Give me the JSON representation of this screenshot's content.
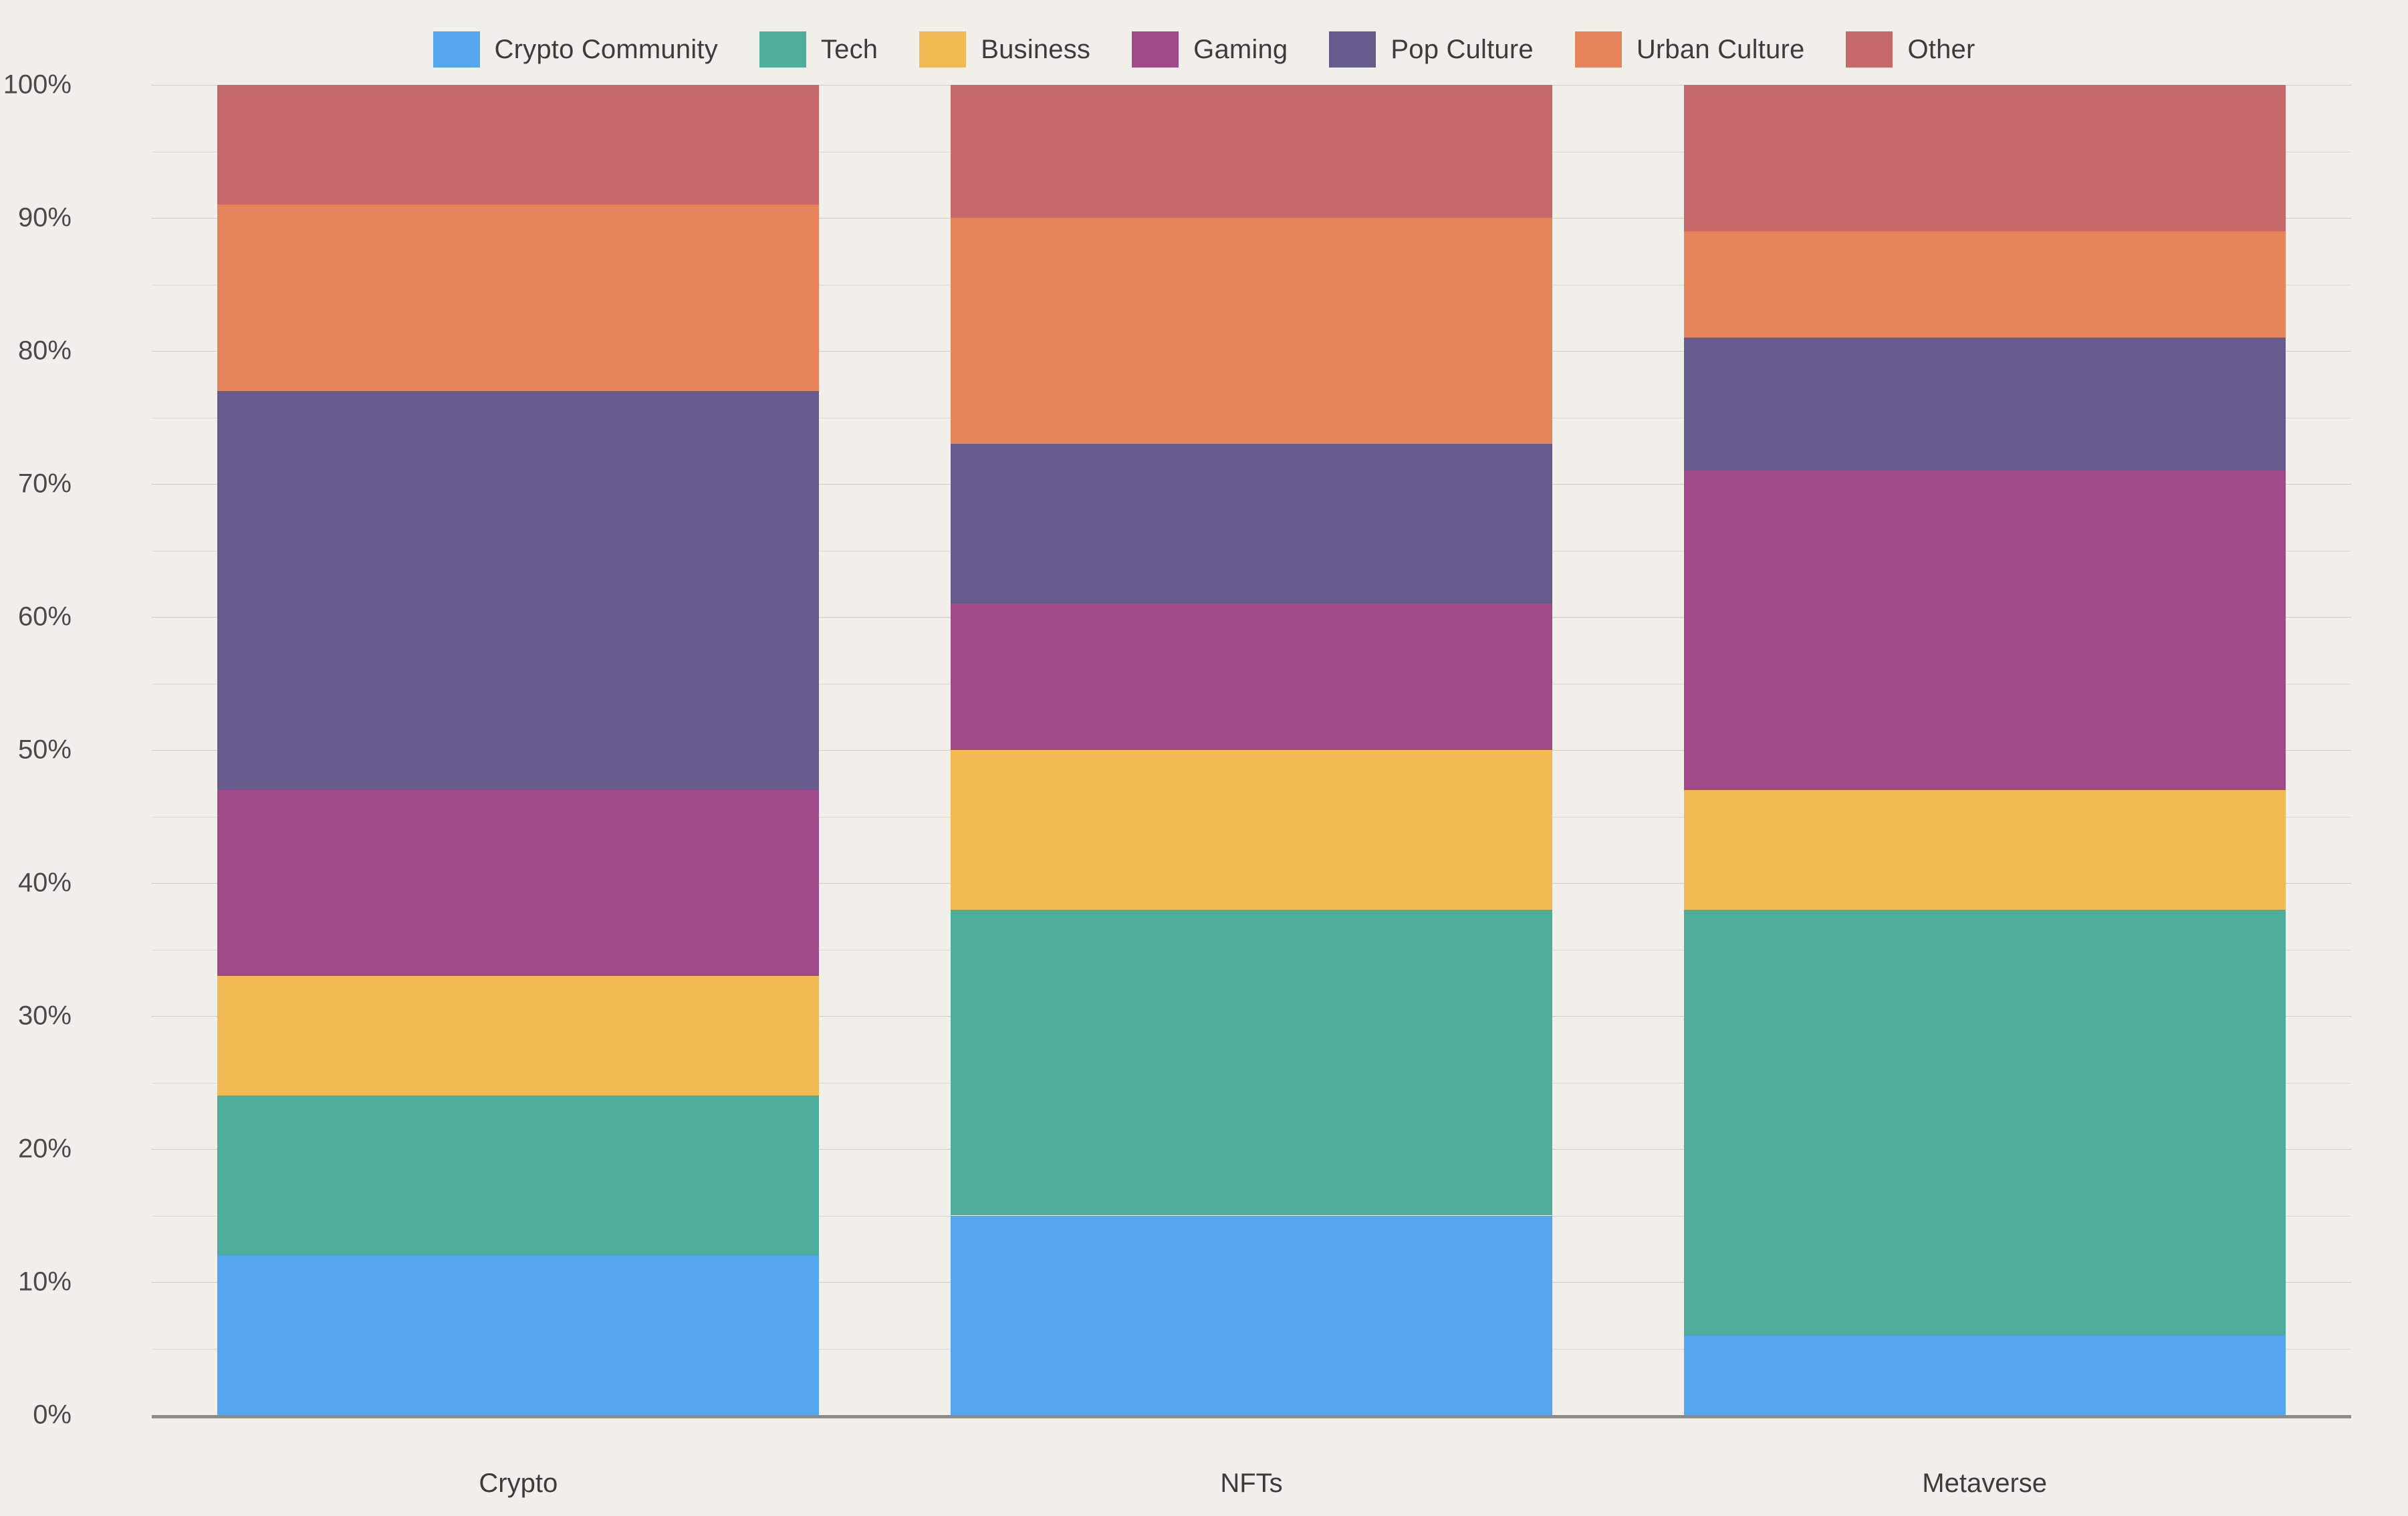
{
  "legend": {
    "position": "top-center",
    "items": [
      {
        "label": "Crypto Community",
        "color": "#54a6ee"
      },
      {
        "label": "Tech",
        "color": "#4fae9b"
      },
      {
        "label": "Business",
        "color": "#f1ba53"
      },
      {
        "label": "Gaming",
        "color": "#a2498a"
      },
      {
        "label": "Pop Culture",
        "color": "#675a8c"
      },
      {
        "label": "Urban Culture",
        "color": "#e6845b"
      },
      {
        "label": "Other",
        "color": "#c5696b"
      }
    ]
  },
  "axes": {
    "y_ticks": [
      "0%",
      "10%",
      "20%",
      "30%",
      "40%",
      "50%",
      "60%",
      "70%",
      "80%",
      "90%",
      "100%"
    ],
    "y_tick_values": [
      0,
      10,
      20,
      30,
      40,
      50,
      60,
      70,
      80,
      90,
      100
    ],
    "minor_step": 5,
    "x_ticks": [
      "Crypto",
      "NFTs",
      "Metaverse"
    ]
  },
  "colors": {
    "background": "#f1efe9",
    "gridline": "#d9d7d0",
    "axis": "#8e8b84",
    "text": "#3c3c3c"
  },
  "chart_data": {
    "type": "bar",
    "stacked": true,
    "normalized": true,
    "title": "",
    "subtitle": "",
    "xlabel": "",
    "ylabel": "",
    "ylim": [
      0,
      100
    ],
    "grid": true,
    "legend_position": "top",
    "categories": [
      "Crypto",
      "NFTs",
      "Metaverse"
    ],
    "series": [
      {
        "name": "Crypto Community",
        "color": "#54a6ee",
        "values": [
          12,
          15,
          6
        ]
      },
      {
        "name": "Tech",
        "color": "#4fae9b",
        "values": [
          12,
          23,
          32
        ]
      },
      {
        "name": "Business",
        "color": "#f1ba53",
        "values": [
          9,
          12,
          9
        ]
      },
      {
        "name": "Gaming",
        "color": "#a2498a",
        "values": [
          14,
          11,
          24
        ]
      },
      {
        "name": "Pop Culture",
        "color": "#675a8c",
        "values": [
          30,
          12,
          10
        ]
      },
      {
        "name": "Urban Culture",
        "color": "#e6845b",
        "values": [
          14,
          17,
          8
        ]
      },
      {
        "name": "Other",
        "color": "#c5696b",
        "values": [
          9,
          10,
          11
        ]
      }
    ]
  }
}
